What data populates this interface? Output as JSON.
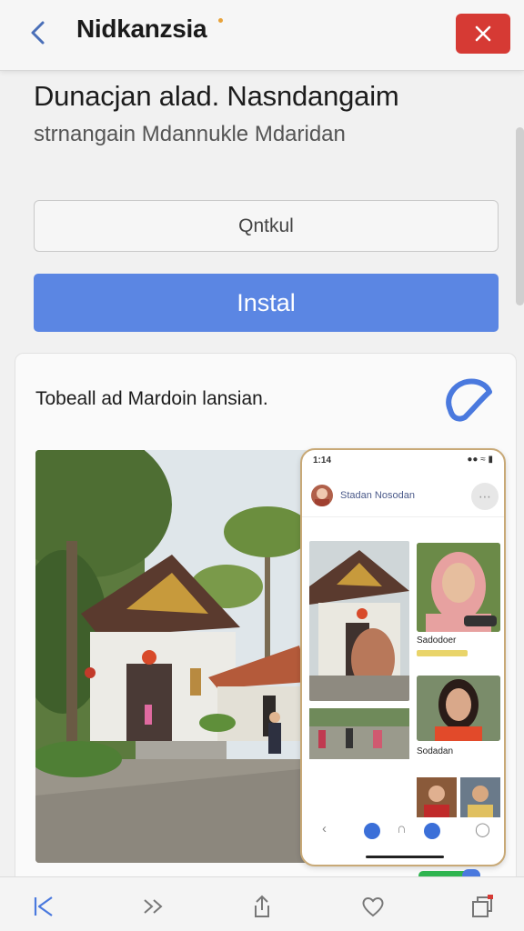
{
  "header": {
    "title": "Nidkanzsia",
    "back_icon": "chevron-left-icon",
    "close_icon": "close-icon",
    "close_color": "#d63a34"
  },
  "main": {
    "heading": "Dunacjan alad. Nasndangaim",
    "subheading": "strnangain Mdannukle Mdaridan",
    "secondary_button": "Qntkul",
    "install_button": "Instal",
    "install_color": "#5b86e3"
  },
  "card": {
    "title": "Tobeall ad Mardoin lansian.",
    "badge_icon": "blue-ring-icon",
    "phone": {
      "status_time": "1:14",
      "contact_name": "Stadan  Nosodan",
      "caption_1": "Sadodoer",
      "caption_2": "Sodadan"
    }
  },
  "bottom_nav": {
    "items": [
      "back-arrow-icon",
      "forward-arrow-icon",
      "share-icon",
      "heart-icon",
      "tabs-icon"
    ]
  }
}
